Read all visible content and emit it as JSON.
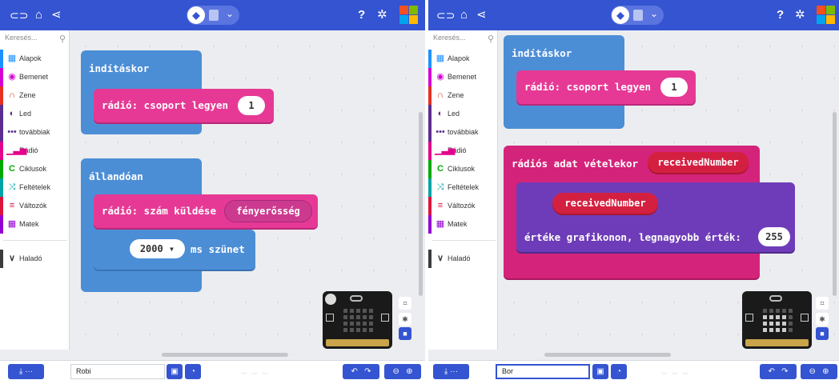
{
  "toolbar": {
    "home_icon": "home-icon",
    "share_icon": "share-icon",
    "help_icon": "help-icon",
    "settings_icon": "gear-icon",
    "toggle_blocks_glyph": "◆",
    "toggle_chevron": "⌄"
  },
  "toolbox": {
    "search_placeholder": "Keresés...",
    "categories": [
      {
        "label": "Alapok",
        "color": "#1e90ff",
        "icon": "grid-icon"
      },
      {
        "label": "Bemenet",
        "color": "#d400d4",
        "icon": "input-icon"
      },
      {
        "label": "Zene",
        "color": "#e63022",
        "icon": "headphones-icon"
      },
      {
        "label": "Led",
        "color": "#5c2d91",
        "icon": "toggle-icon"
      },
      {
        "label": "továbbiak",
        "color": "#5c2d91",
        "icon": "more-icon"
      },
      {
        "label": "Rádió",
        "color": "#e3008c",
        "icon": "signal-icon"
      },
      {
        "label": "Ciklusok",
        "color": "#00aa00",
        "icon": "loop-icon"
      },
      {
        "label": "Feltételek",
        "color": "#00a4a6",
        "icon": "shuffle-icon"
      },
      {
        "label": "Változók",
        "color": "#dc143c",
        "icon": "list-icon"
      },
      {
        "label": "Matek",
        "color": "#9400d3",
        "icon": "calculator-icon"
      },
      {
        "label": "Haladó",
        "color": "#3c3c3c",
        "icon": "chevron-down-icon"
      }
    ]
  },
  "left": {
    "on_start": "indításkor",
    "radio_set_group": "rádió: csoport legyen",
    "group_value": "1",
    "forever": "állandóan",
    "radio_send_number": "rádió: szám küldése",
    "send_value": "fényerősség",
    "pause_value": "2000 ▾",
    "pause_suffix": "ms szünet",
    "project_name": "Robi"
  },
  "right": {
    "on_start": "indításkor",
    "radio_set_group": "rádió: csoport legyen",
    "group_value": "1",
    "on_received": "rádiós adat vételekor",
    "received_param": "receivedNumber",
    "plot_value": "receivedNumber",
    "plot_text": "értéke grafikonon, legnagyobb érték:",
    "plot_max": "255",
    "project_name": "Bor"
  },
  "colors": {
    "topbar": "#3454d1",
    "workspace": "#ecedf0",
    "basic_block": "#4c8ed6",
    "radio_block": "#e63995",
    "led_block": "#6e3cb8",
    "variable_pill": "#d42040"
  }
}
